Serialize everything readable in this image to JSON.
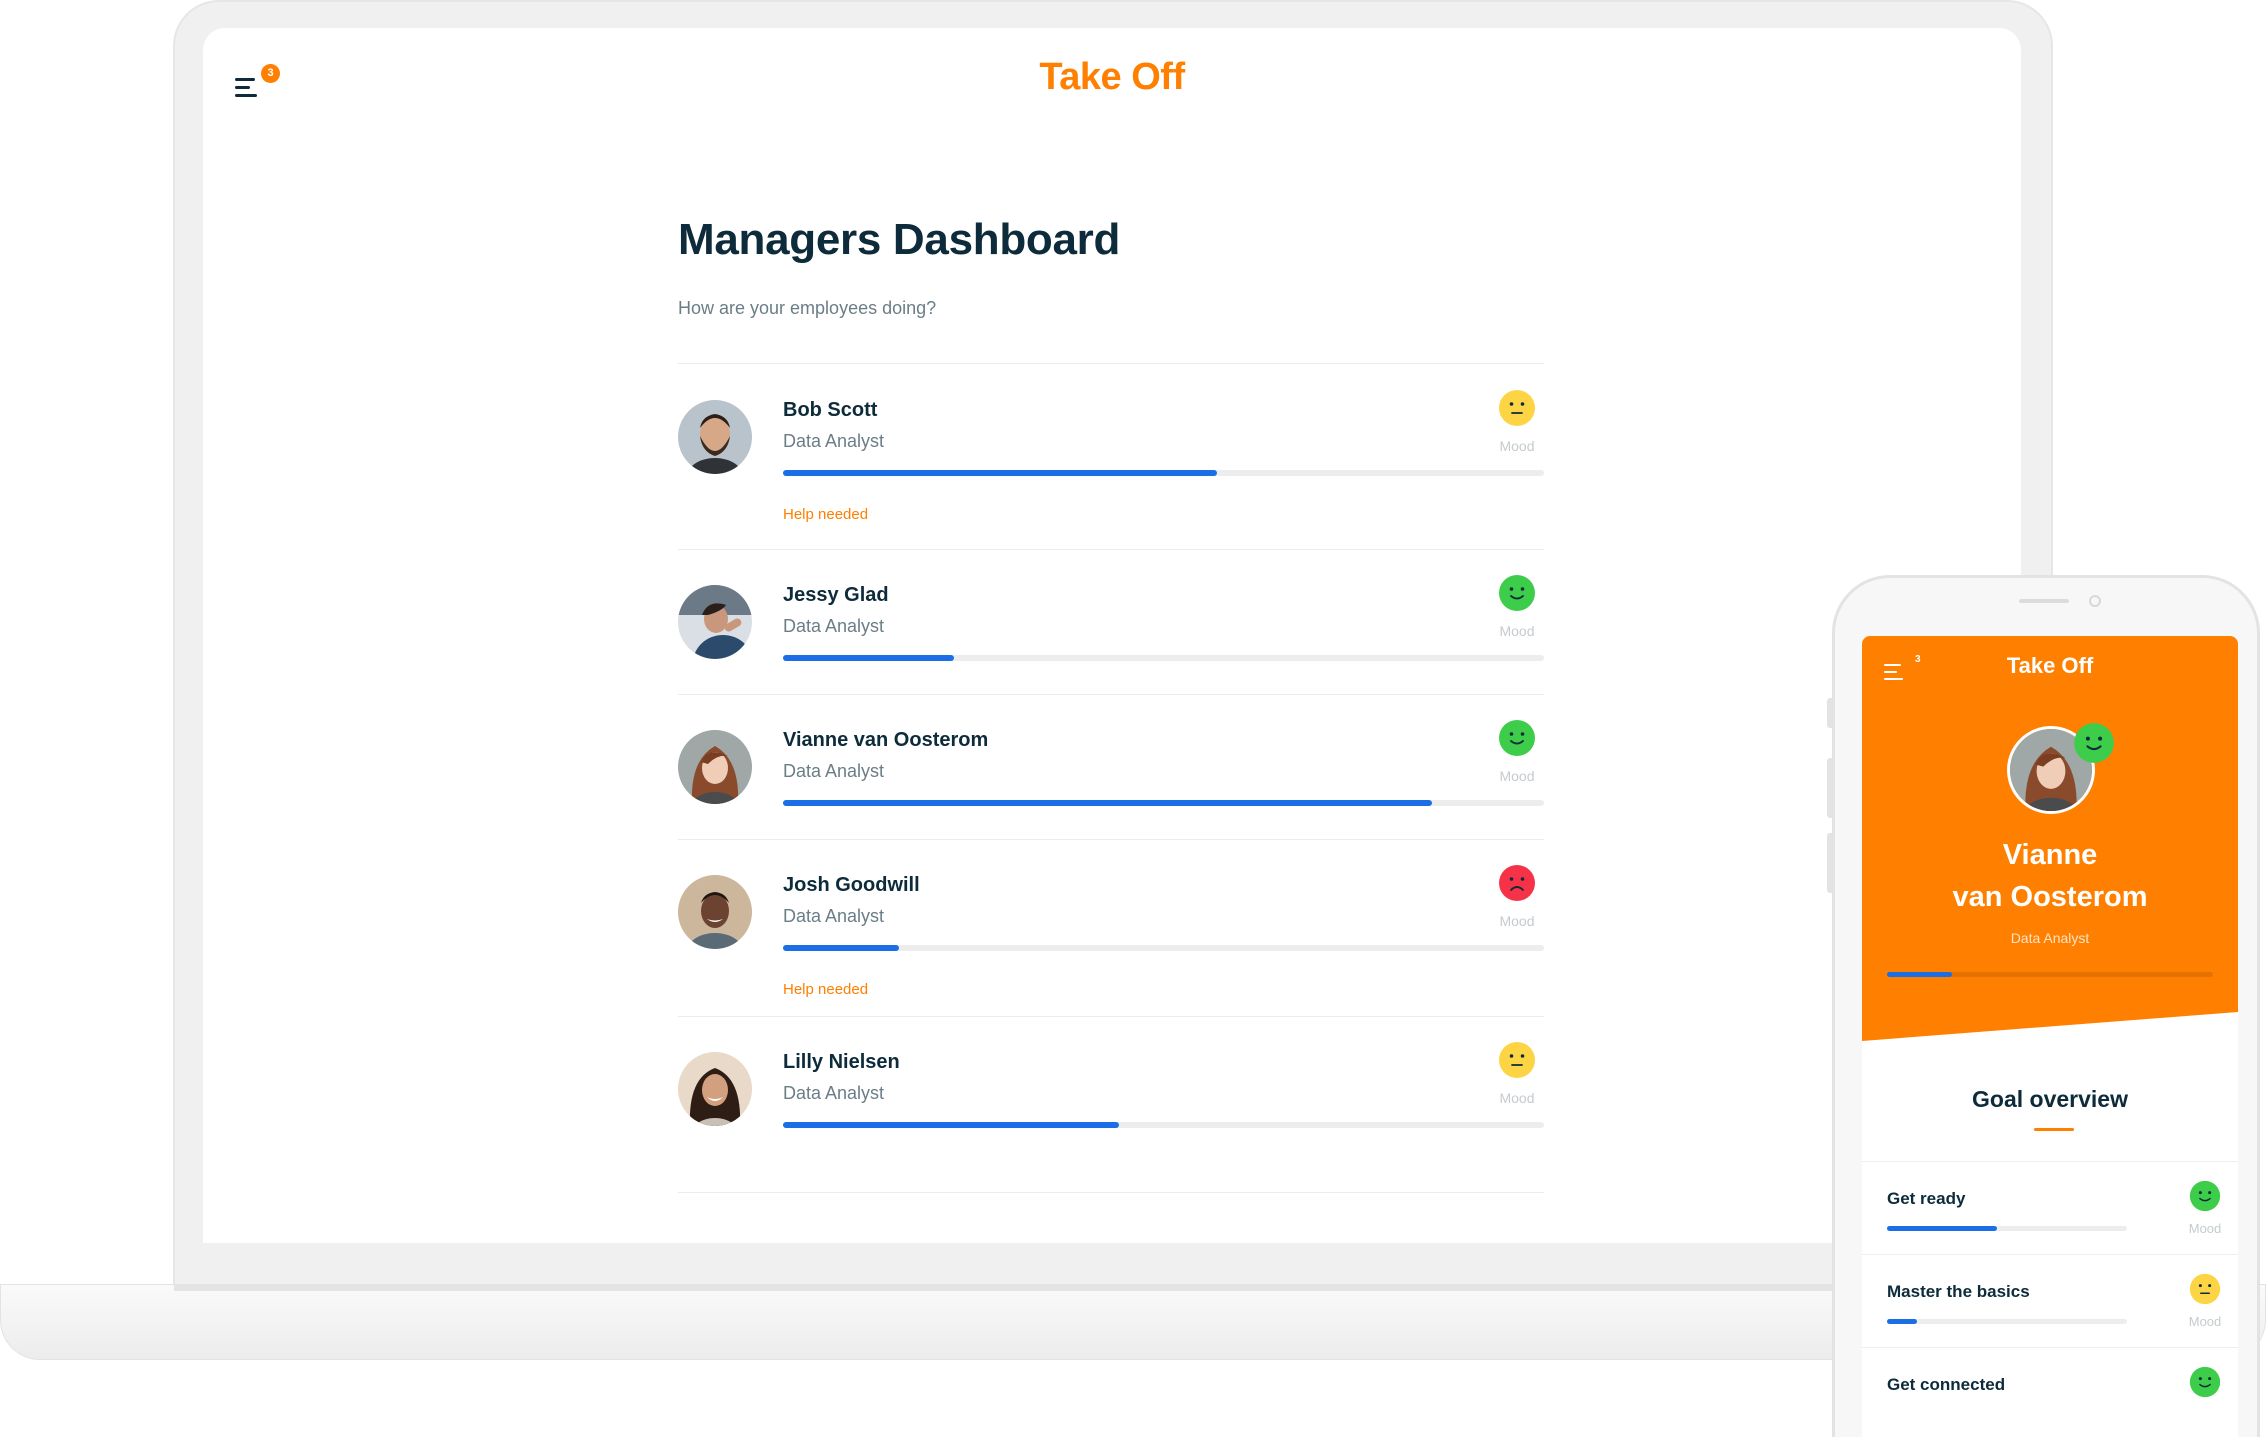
{
  "laptop": {
    "brand": "Take Off",
    "menu_badge": "3",
    "title": "Managers Dashboard",
    "subtitle": "How are your employees doing?",
    "mood_label": "Mood",
    "help_label": "Help needed",
    "employees": [
      {
        "name": "Bob Scott",
        "role": "Data Analyst",
        "progress": 0.57,
        "mood": "neutral",
        "help_needed": true
      },
      {
        "name": "Jessy Glad",
        "role": "Data Analyst",
        "progress": 0.225,
        "mood": "happy",
        "help_needed": false
      },
      {
        "name": "Vianne van Oosterom",
        "role": "Data Analyst",
        "progress": 0.853,
        "mood": "happy",
        "help_needed": false
      },
      {
        "name": "Josh Goodwill",
        "role": "Data Analyst",
        "progress": 0.152,
        "mood": "sad",
        "help_needed": true
      },
      {
        "name": "Lilly Nielsen",
        "role": "Data Analyst",
        "progress": 0.442,
        "mood": "neutral",
        "help_needed": false
      }
    ]
  },
  "phone": {
    "brand": "Take Off",
    "menu_badge": "3",
    "name_line1": "Vianne",
    "name_line2": "van Oosterom",
    "role": "Data Analyst",
    "progress": 0.2,
    "mood": "happy",
    "goal_title": "Goal overview",
    "mood_label": "Mood",
    "goals": [
      {
        "name": "Get ready",
        "progress": 0.46,
        "mood": "happy"
      },
      {
        "name": "Master the basics",
        "progress": 0.125,
        "mood": "neutral"
      },
      {
        "name": "Get connected",
        "progress": 0.0,
        "mood": "happy"
      }
    ]
  },
  "colors": {
    "brand": "#ff7f00",
    "navy": "#0d2b3a",
    "progress": "#1b6ee6",
    "mood_happy": "#3dcd4b",
    "mood_neutral": "#fdd443",
    "mood_sad": "#f53248"
  }
}
